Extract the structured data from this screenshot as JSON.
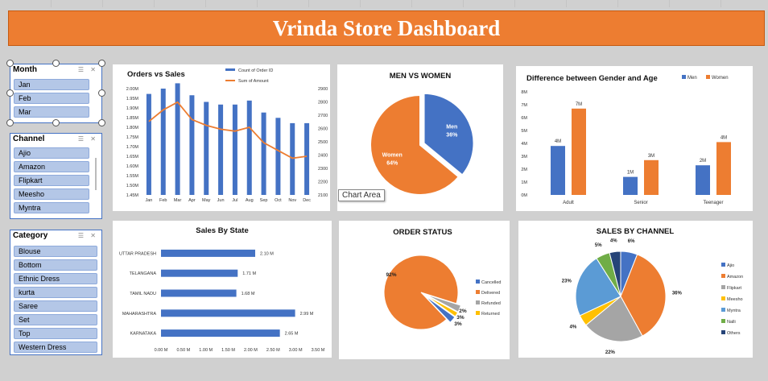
{
  "dashboard_title": "Vrinda Store Dashboard",
  "slicers": {
    "month": {
      "title": "Month",
      "items": [
        "Jan",
        "Feb",
        "Mar"
      ]
    },
    "channel": {
      "title": "Channel",
      "items": [
        "Ajio",
        "Amazon",
        "Flipkart",
        "Meesho",
        "Myntra"
      ]
    },
    "category": {
      "title": "Category",
      "items": [
        "Blouse",
        "Bottom",
        "Ethnic Dress",
        "kurta",
        "Saree",
        "Set",
        "Top",
        "Western Dress"
      ]
    }
  },
  "tooltip": "Chart Area",
  "colors": {
    "blue": "#4472c4",
    "orange": "#ed7d31",
    "gray": "#a5a5a5",
    "yellow": "#ffc000",
    "lightblue": "#5b9bd5",
    "green": "#70ad47",
    "navy": "#264478"
  },
  "chart_data": [
    {
      "id": "orders_vs_sales",
      "type": "bar",
      "title": "Orders vs Sales",
      "categories": [
        "Jan",
        "Feb",
        "Mar",
        "Apr",
        "May",
        "Jun",
        "Jul",
        "Aug",
        "Sep",
        "Oct",
        "Nov",
        "Dec"
      ],
      "series": [
        {
          "name": "Count of Order ID",
          "type": "bar",
          "axis": "right",
          "values": [
            2860,
            2900,
            2940,
            2850,
            2800,
            2780,
            2780,
            2810,
            2720,
            2680,
            2640,
            2640
          ]
        },
        {
          "name": "Sum of Amount",
          "type": "line",
          "axis": "left",
          "values": [
            1.83,
            1.89,
            1.93,
            1.84,
            1.81,
            1.79,
            1.78,
            1.8,
            1.72,
            1.68,
            1.64,
            1.65
          ]
        }
      ],
      "left_ticks": [
        "1.45M",
        "1.50M",
        "1.55M",
        "1.60M",
        "1.65M",
        "1.70M",
        "1.75M",
        "1.80M",
        "1.85M",
        "1.90M",
        "1.95M",
        "2.00M"
      ],
      "right_ticks": [
        "2100",
        "2200",
        "2300",
        "2400",
        "2500",
        "2600",
        "2700",
        "2800",
        "2900"
      ],
      "ylim_left": [
        1.45,
        2.0
      ],
      "ylim_right": [
        2100,
        2900
      ]
    },
    {
      "id": "men_vs_women",
      "type": "pie",
      "title": "MEN VS WOMEN",
      "slices": [
        {
          "label": "Men",
          "value": 36,
          "text": "36%"
        },
        {
          "label": "Women",
          "value": 64,
          "text": "64%"
        }
      ]
    },
    {
      "id": "gender_age",
      "type": "bar",
      "title": "Difference between Gender and Age",
      "categories": [
        "Adult",
        "Senior",
        "Teenager"
      ],
      "series": [
        {
          "name": "Men",
          "values": [
            3.8,
            1.4,
            2.3
          ],
          "labels": [
            "4M",
            "1M",
            "2M"
          ]
        },
        {
          "name": "Women",
          "values": [
            6.7,
            2.7,
            4.1
          ],
          "labels": [
            "7M",
            "3M",
            "4M"
          ]
        }
      ],
      "yticks": [
        "0M",
        "1M",
        "2M",
        "3M",
        "4M",
        "5M",
        "6M",
        "7M",
        "8M"
      ],
      "ylim": [
        0,
        8
      ]
    },
    {
      "id": "sales_by_state",
      "type": "bar",
      "orientation": "horizontal",
      "title": "Sales  By State",
      "categories": [
        "UTTAR PRADESH",
        "TELANGANA",
        "TAMIL NADU",
        "MAHARASHTRA",
        "KARNATAKA"
      ],
      "values": [
        2.1,
        1.71,
        1.68,
        2.99,
        2.65
      ],
      "labels": [
        "2.10 M",
        "1.71 M",
        "1.68 M",
        "2.99 M",
        "2.65 M"
      ],
      "xticks": [
        "0.00 M",
        "0.50 M",
        "1.00 M",
        "1.50 M",
        "2.00 M",
        "2.50 M",
        "3.00 M",
        "3.50 M"
      ],
      "xlim": [
        0,
        3.5
      ]
    },
    {
      "id": "order_status",
      "type": "pie",
      "title": "ORDER STATUS",
      "legend": "right",
      "slices": [
        {
          "label": "Cancelled",
          "value": 3,
          "text": "3%"
        },
        {
          "label": "Delivered",
          "value": 92,
          "text": "92%"
        },
        {
          "label": "Refunded",
          "value": 3,
          "text": "3%"
        },
        {
          "label": "Returned",
          "value": 2,
          "text": "2%"
        }
      ]
    },
    {
      "id": "sales_by_channel",
      "type": "pie",
      "title": "SALES BY CHANNEL",
      "legend": "right",
      "slices": [
        {
          "label": "Ajio",
          "value": 6,
          "text": "6%"
        },
        {
          "label": "Amazon",
          "value": 36,
          "text": "36%"
        },
        {
          "label": "Flipkart",
          "value": 22,
          "text": "22%"
        },
        {
          "label": "Meesho",
          "value": 4,
          "text": "4%"
        },
        {
          "label": "Myntra",
          "value": 23,
          "text": "23%"
        },
        {
          "label": "Nalli",
          "value": 5,
          "text": "5%"
        },
        {
          "label": "Others",
          "value": 4,
          "text": "4%"
        }
      ]
    }
  ]
}
